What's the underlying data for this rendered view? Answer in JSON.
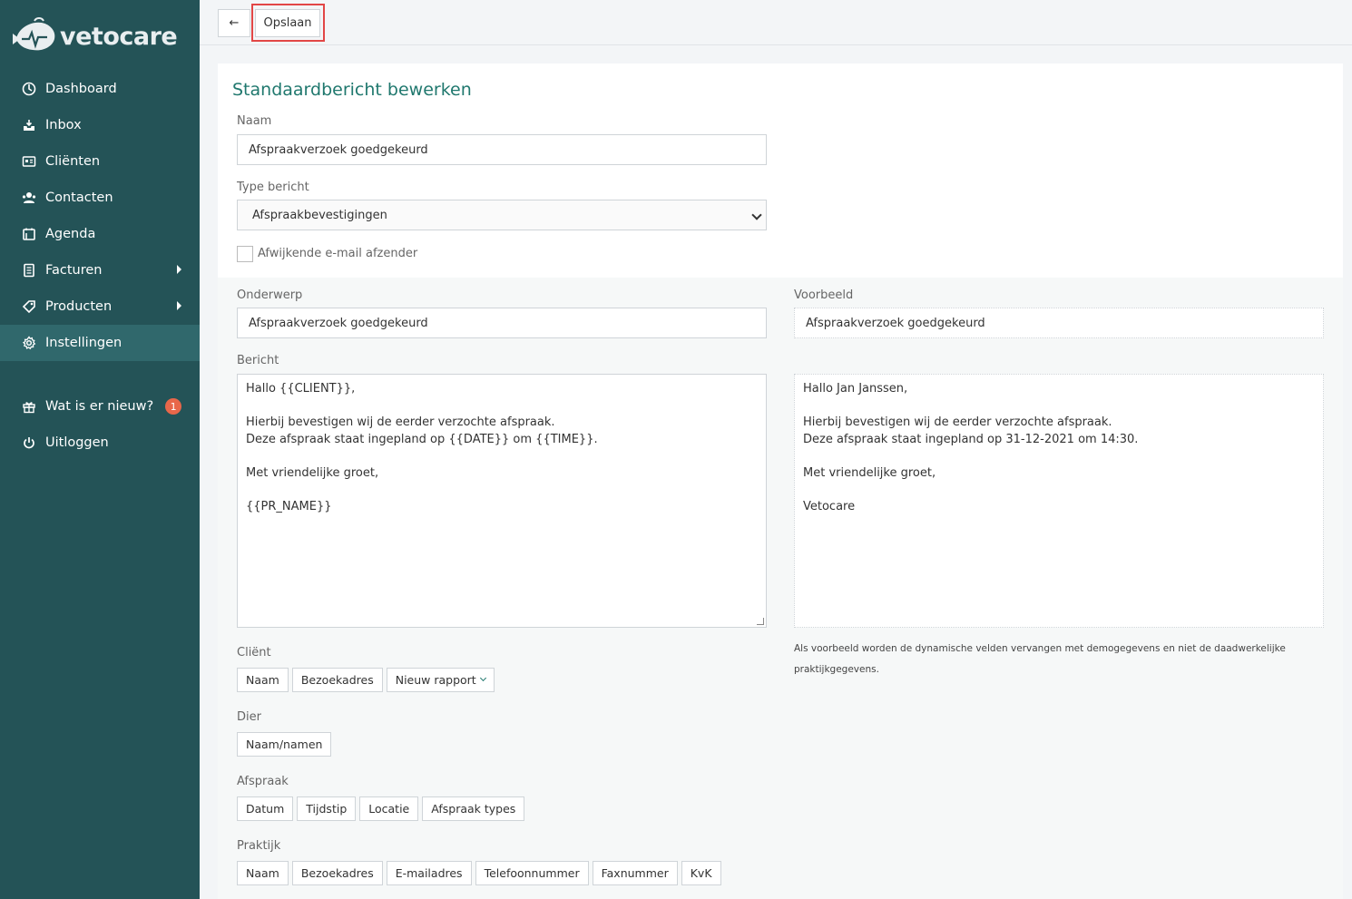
{
  "brand": {
    "name": "vetocare"
  },
  "sidebar": {
    "items": [
      {
        "label": "Dashboard",
        "icon": "dashboard-icon"
      },
      {
        "label": "Inbox",
        "icon": "inbox-icon"
      },
      {
        "label": "Cliënten",
        "icon": "clients-icon"
      },
      {
        "label": "Contacten",
        "icon": "contacts-icon"
      },
      {
        "label": "Agenda",
        "icon": "agenda-icon"
      },
      {
        "label": "Facturen",
        "icon": "invoices-icon"
      },
      {
        "label": "Producten",
        "icon": "products-icon"
      },
      {
        "label": "Instellingen",
        "icon": "settings-icon"
      }
    ],
    "secondary": [
      {
        "label": "Wat is er nieuw?",
        "icon": "gift-icon",
        "badge": "1"
      },
      {
        "label": "Uitloggen",
        "icon": "power-icon"
      }
    ],
    "active": "Instellingen"
  },
  "toolbar": {
    "back_label": "←",
    "save_label": "Opslaan"
  },
  "form": {
    "title": "Standaardbericht bewerken",
    "naam_label": "Naam",
    "naam_value": "Afspraakverzoek goedgekeurd",
    "type_label": "Type bericht",
    "type_value": "Afspraakbevestigingen",
    "alt_sender_label": "Afwijkende e-mail afzender",
    "alt_sender_checked": false,
    "onderwerp_label": "Onderwerp",
    "onderwerp_value": "Afspraakverzoek goedgekeurd",
    "bericht_label": "Bericht",
    "bericht_lines": [
      "Hallo {{CLIENT}},",
      "",
      "Hierbij bevestigen wij de eerder verzochte afspraak.",
      "Deze afspraak staat ingepland op {{DATE}} om {{TIME}}.",
      "",
      "Met vriendelijke groet,",
      "",
      "{{PR_NAME}}"
    ]
  },
  "preview": {
    "label": "Voorbeeld",
    "subject": "Afspraakverzoek goedgekeurd",
    "lines": [
      "Hallo Jan Janssen,",
      "",
      "Hierbij bevestigen wij de eerder verzochte afspraak.",
      "Deze afspraak staat ingepland op 31-12-2021 om 14:30.",
      "",
      "Met vriendelijke groet,",
      "",
      "Vetocare"
    ],
    "note": "Als voorbeeld worden de dynamische velden vervangen met demogegevens en niet de daadwerkelijke praktijkgegevens."
  },
  "field_groups": [
    {
      "label": "Cliënt",
      "buttons": [
        "Naam",
        "Bezoekadres",
        "Nieuw rapport"
      ]
    },
    {
      "label": "Dier",
      "buttons": [
        "Naam/namen"
      ]
    },
    {
      "label": "Afspraak",
      "buttons": [
        "Datum",
        "Tijdstip",
        "Locatie",
        "Afspraak types"
      ]
    },
    {
      "label": "Praktijk",
      "buttons": [
        "Naam",
        "Bezoekadres",
        "E-mailadres",
        "Telefoonnummer",
        "Faxnummer",
        "KvK"
      ]
    }
  ],
  "colors": {
    "sidebar": "#245357",
    "sidebar_active": "#30686c",
    "accent": "#20786e",
    "badge": "#e8674a",
    "highlight": "#e24646"
  }
}
